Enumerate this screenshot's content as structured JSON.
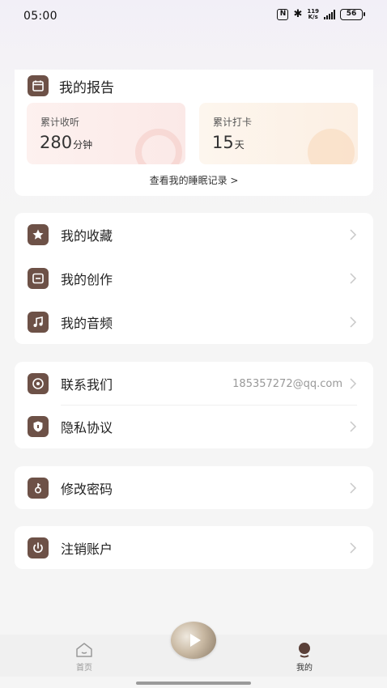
{
  "status_bar": {
    "time": "05:00",
    "nfc": "N",
    "bluetooth": "✱",
    "net_speed_value": "119",
    "net_speed_unit": "K/s",
    "battery": "56"
  },
  "report": {
    "title": "我的报告",
    "listen": {
      "label": "累计收听",
      "value": "280",
      "unit": "分钟"
    },
    "checkin": {
      "label": "累计打卡",
      "value": "15",
      "unit": "天"
    },
    "sleep_link": "查看我的睡眠记录 >"
  },
  "menu_group_1": [
    {
      "label": "我的收藏",
      "icon": "star-icon"
    },
    {
      "label": "我的创作",
      "icon": "document-icon"
    },
    {
      "label": "我的音频",
      "icon": "music-note-icon"
    }
  ],
  "menu_group_2": [
    {
      "label": "联系我们",
      "icon": "contact-icon",
      "value": "185357272@qq.com"
    },
    {
      "label": "隐私协议",
      "icon": "shield-icon"
    }
  ],
  "menu_group_3": [
    {
      "label": "修改密码",
      "icon": "key-icon"
    }
  ],
  "menu_group_4": [
    {
      "label": "注销账户",
      "icon": "power-icon"
    }
  ],
  "tabs": {
    "home": "首页",
    "me": "我的"
  },
  "colors": {
    "icon_bg": "#6d5147",
    "card_bg": "#ffffff",
    "page_bg": "#f5f5f5"
  }
}
